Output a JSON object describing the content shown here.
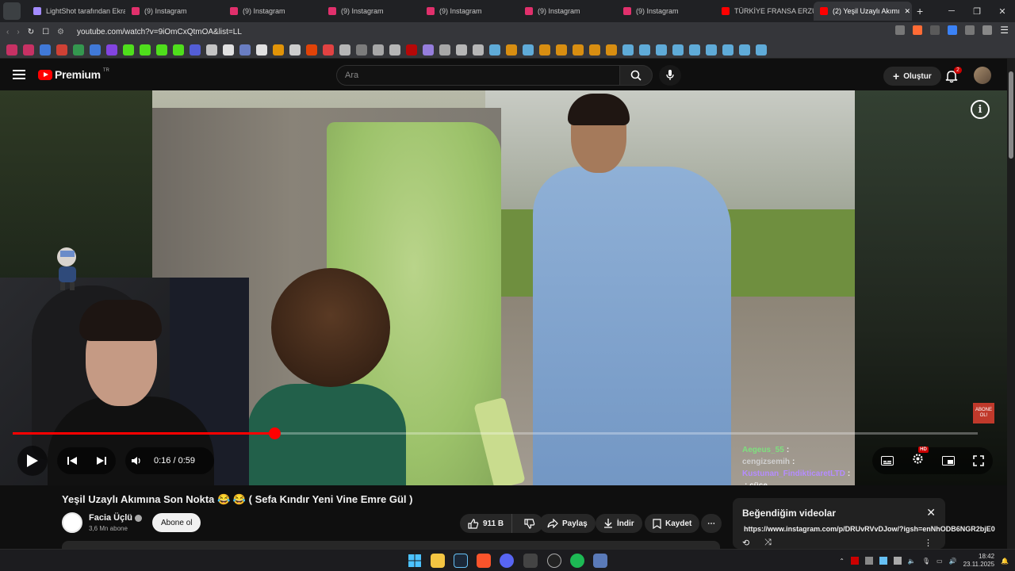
{
  "browser": {
    "tabs": [
      {
        "label": "LightShot tarafından Ekra",
        "color": "#a38bff",
        "active": false
      },
      {
        "label": "(9) Instagram",
        "color": "#e1306c",
        "active": false
      },
      {
        "label": "(9) Instagram",
        "color": "#e1306c",
        "active": false
      },
      {
        "label": "(9) Instagram",
        "color": "#e1306c",
        "active": false
      },
      {
        "label": "(9) Instagram",
        "color": "#e1306c",
        "active": false
      },
      {
        "label": "(9) Instagram",
        "color": "#e1306c",
        "active": false
      },
      {
        "label": "(9) Instagram",
        "color": "#e1306c",
        "active": false
      },
      {
        "label": "TÜRKİYE FRANSA ERZUR",
        "color": "#ff0000",
        "active": false
      },
      {
        "label": "(2) Yeşil Uzaylı Akımı",
        "color": "#ff0000",
        "active": true
      }
    ],
    "new_tab": "+",
    "url": "youtube.com/watch?v=9iOmCxQtmOA&list=LL"
  },
  "youtube": {
    "logo_text": "Premium",
    "logo_region": "TR",
    "search_placeholder": "Ara",
    "create_label": "Oluştur",
    "notification_count": "2"
  },
  "player": {
    "current_time": "0:16",
    "duration": "0:59",
    "time_separator": "/",
    "progress_fraction": 0.271,
    "hd_badge": "HD",
    "abone_badge": "ABONE OL!"
  },
  "chat": [
    {
      "user": "Aegeus_55",
      "text": ":",
      "color": "#7ee07e"
    },
    {
      "user": "cengizsemih",
      "text": ":",
      "color": "#d0d0d0"
    },
    {
      "user": "Kustunan_FindikticaretLTD",
      "text": ":",
      "color": "#b58cff"
    },
    {
      "user": "",
      "text": ": cüce",
      "color": "#ffffff"
    }
  ],
  "video": {
    "title": "Yeşil Uzaylı Akımına Son Nokta 😂 😂  ( Sefa Kındır Yeni Vine Emre Gül )",
    "channel": "Facia Üçlü",
    "subscribers": "3,6 Mn abone",
    "subscribe_label": "Abone ol",
    "likes": "911 B",
    "share_label": "Paylaş",
    "download_label": "İndir",
    "save_label": "Kaydet"
  },
  "popup": {
    "title": "Beğendiğim videolar",
    "close": "✕",
    "link": "https://www.instagram.com/p/DRUvRVvDJow/?igsh=enNhODB6NGR2bjE0"
  },
  "taskbar": {
    "time": "18:42",
    "date": "23.11.2025"
  },
  "colors": {
    "accent_red": "#ff0000",
    "background": "#0f0f0f"
  }
}
